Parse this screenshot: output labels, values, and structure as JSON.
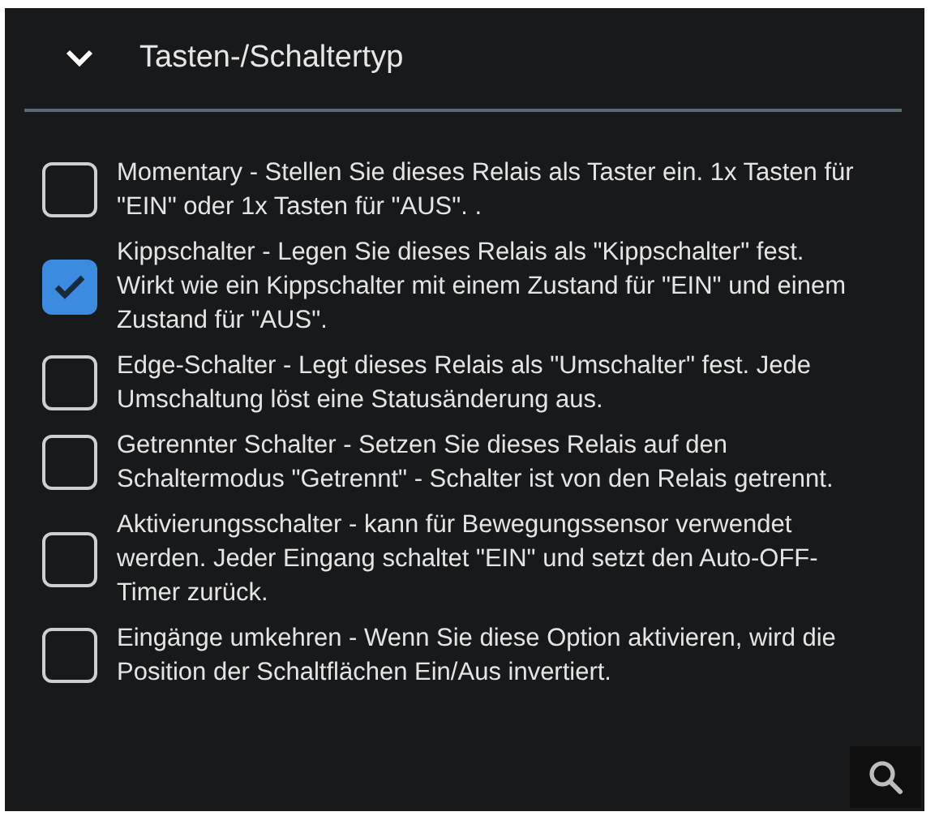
{
  "section": {
    "title": "Tasten-/Schaltertyp",
    "expanded": true
  },
  "options": [
    {
      "label": "Momentary - Stellen Sie dieses Relais als Taster ein. 1x Tasten für \"EIN\" oder 1x Tasten für \"AUS\". .",
      "checked": false
    },
    {
      "label": "Kippschalter - Legen Sie dieses Relais als \"Kippschalter\" fest. Wirkt wie ein Kippschalter mit einem Zustand für \"EIN\" und einem Zustand für \"AUS\".",
      "checked": true
    },
    {
      "label": "Edge-Schalter - Legt dieses Relais als \"Umschalter\" fest. Jede Umschaltung löst eine Statusänderung aus.",
      "checked": false
    },
    {
      "label": "Getrennter Schalter - Setzen Sie dieses Relais auf den Schaltermodus \"Getrennt\" - Schalter ist von den Relais getrennt.",
      "checked": false
    },
    {
      "label": "Aktivierungsschalter - kann für Bewegungssensor verwendet werden. Jeder Eingang schaltet \"EIN\" und setzt den Auto-OFF-Timer zurück.",
      "checked": false
    },
    {
      "label": "Eingänge umkehren - Wenn Sie diese Option aktivieren, wird die Position der Schaltflächen Ein/Aus invertiert.",
      "checked": false
    }
  ]
}
